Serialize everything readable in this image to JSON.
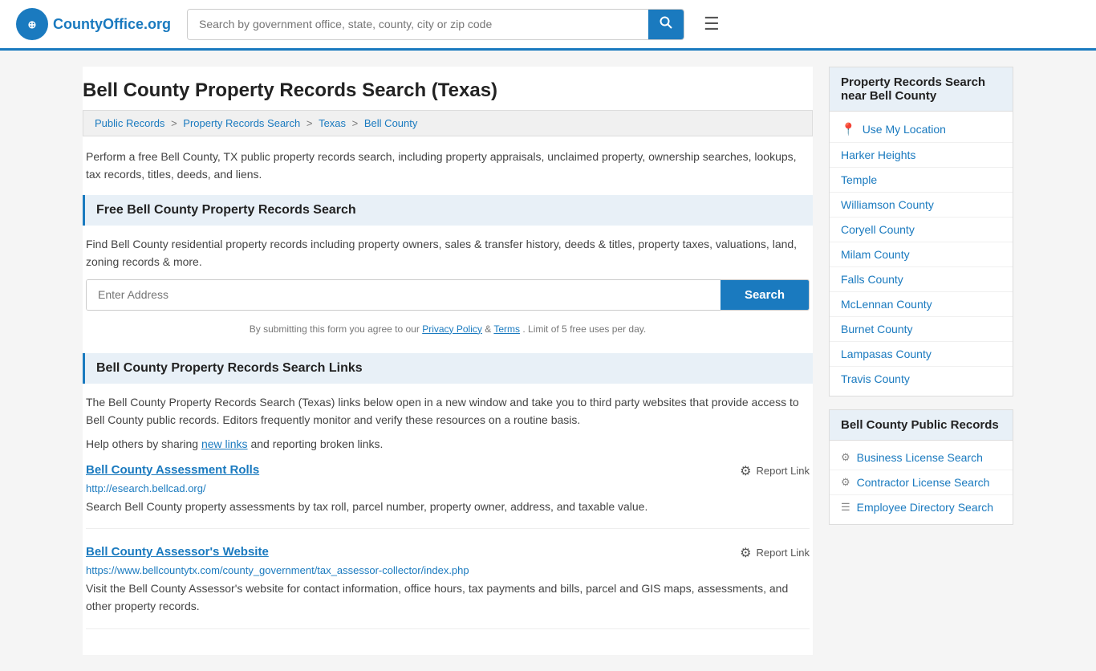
{
  "header": {
    "logo_text": "CountyOffice",
    "logo_suffix": ".org",
    "search_placeholder": "Search by government office, state, county, city or zip code"
  },
  "page": {
    "title": "Bell County Property Records Search (Texas)",
    "breadcrumb": [
      {
        "label": "Public Records",
        "href": "#"
      },
      {
        "label": "Property Records Search",
        "href": "#"
      },
      {
        "label": "Texas",
        "href": "#"
      },
      {
        "label": "Bell County",
        "href": "#"
      }
    ],
    "description": "Perform a free Bell County, TX public property records search, including property appraisals, unclaimed property, ownership searches, lookups, tax records, titles, deeds, and liens."
  },
  "free_search": {
    "heading": "Free Bell County Property Records Search",
    "body": "Find Bell County residential property records including property owners, sales & transfer history, deeds & titles, property taxes, valuations, land, zoning records & more.",
    "address_placeholder": "Enter Address",
    "search_button": "Search",
    "disclaimer": "By submitting this form you agree to our",
    "privacy_label": "Privacy Policy",
    "terms_label": "Terms",
    "limit_text": ". Limit of 5 free uses per day."
  },
  "links_section": {
    "heading": "Bell County Property Records Search Links",
    "description": "The Bell County Property Records Search (Texas) links below open in a new window and take you to third party websites that provide access to Bell County public records. Editors frequently monitor and verify these resources on a routine basis.",
    "new_links_note": "Help others by sharing",
    "new_links_anchor": "new links",
    "new_links_suffix": " and reporting broken links.",
    "records": [
      {
        "title": "Bell County Assessment Rolls",
        "url": "http://esearch.bellcad.org/",
        "description": "Search Bell County property assessments by tax roll, parcel number, property owner, address, and taxable value.",
        "report_label": "Report Link"
      },
      {
        "title": "Bell County Assessor's Website",
        "url": "https://www.bellcountytx.com/county_government/tax_assessor-collector/index.php",
        "description": "Visit the Bell County Assessor's website for contact information, office hours, tax payments and bills, parcel and GIS maps, assessments, and other property records.",
        "report_label": "Report Link"
      }
    ]
  },
  "sidebar": {
    "property_records_heading": "Property Records Search near Bell County",
    "use_location_label": "Use My Location",
    "nearby_locations": [
      {
        "label": "Harker Heights",
        "href": "#"
      },
      {
        "label": "Temple",
        "href": "#"
      },
      {
        "label": "Williamson County",
        "href": "#"
      },
      {
        "label": "Coryell County",
        "href": "#"
      },
      {
        "label": "Milam County",
        "href": "#"
      },
      {
        "label": "Falls County",
        "href": "#"
      },
      {
        "label": "McLennan County",
        "href": "#"
      },
      {
        "label": "Burnet County",
        "href": "#"
      },
      {
        "label": "Lampasas County",
        "href": "#"
      },
      {
        "label": "Travis County",
        "href": "#"
      }
    ],
    "public_records_heading": "Bell County Public Records",
    "public_records_links": [
      {
        "label": "Business License Search",
        "href": "#",
        "icon": "⚙"
      },
      {
        "label": "Contractor License Search",
        "href": "#",
        "icon": "⚙"
      },
      {
        "label": "Employee Directory Search",
        "href": "#",
        "icon": "☰"
      }
    ]
  }
}
